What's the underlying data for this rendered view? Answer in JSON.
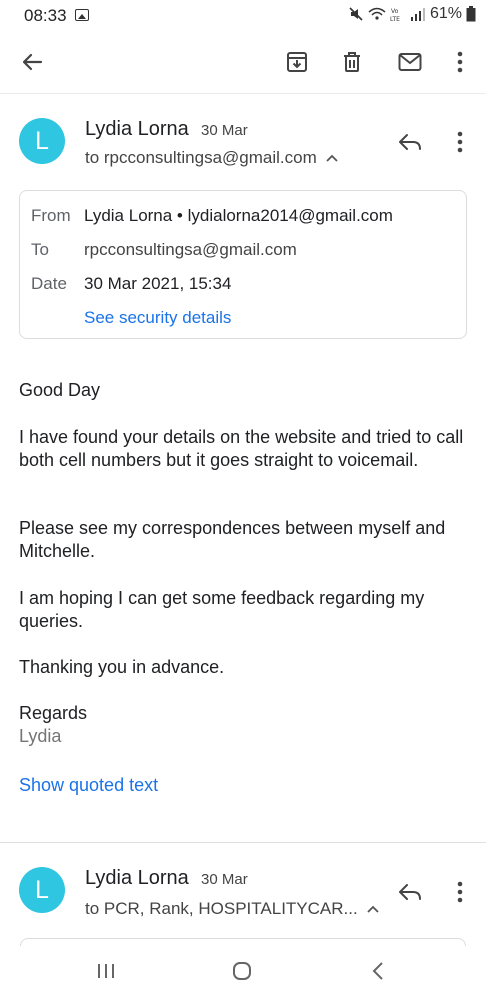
{
  "status_bar": {
    "time": "08:33",
    "battery": "61%"
  },
  "toolbar": {
    "icons": [
      "back-arrow-icon",
      "archive-icon",
      "delete-icon",
      "mark-unread-icon",
      "more-vert-icon"
    ]
  },
  "messages": [
    {
      "avatar_letter": "L",
      "sender": "Lydia Lorna",
      "date": "30 Mar",
      "recipients": "to rpcconsultingsa@gmail.com",
      "details": {
        "from_label": "From",
        "from_value": "Lydia Lorna • lydialorna2014@gmail.com",
        "to_label": "To",
        "to_value": "rpcconsultingsa@gmail.com",
        "date_label": "Date",
        "date_value": "30 Mar 2021, 15:34",
        "security_link": "See security details"
      },
      "body": {
        "greeting": "Good Day",
        "p1": "I have found your details on the website and tried to call both cell numbers but it goes straight to voicemail.",
        "p2": "Please see my correspondences between myself and Mitchelle.",
        "p3": "I am hoping I can get some feedback regarding my queries.",
        "p4": "Thanking you in advance.",
        "sign_off": "Regards",
        "signature": "Lydia"
      },
      "show_quoted": "Show quoted text"
    },
    {
      "avatar_letter": "L",
      "sender": "Lydia Lorna",
      "date": "30 Mar",
      "recipients": "to PCR, Rank, HOSPITALITYCAR..."
    }
  ],
  "colors": {
    "avatar": "#2ec6e0",
    "link": "#1a73e8"
  }
}
